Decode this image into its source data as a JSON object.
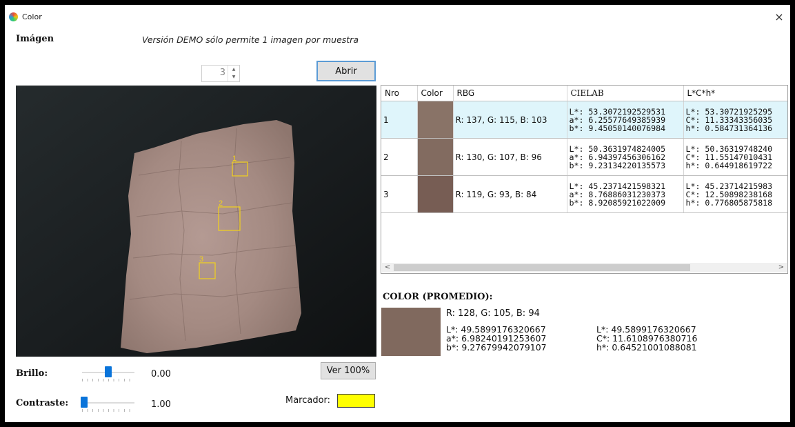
{
  "window": {
    "title": "Color",
    "close_glyph": "×"
  },
  "header": {
    "image_label": "Imágen",
    "demo_notice": "Versión DEMO sólo permite 1 imagen por muestra"
  },
  "spinner": {
    "value": "3",
    "up": "▲",
    "down": "▼"
  },
  "buttons": {
    "open": "Abrir",
    "view_full": "Ver 100%"
  },
  "photo": {
    "marker_color": "#f2d21c",
    "markers": [
      {
        "label": "1"
      },
      {
        "label": "2"
      },
      {
        "label": "3"
      }
    ]
  },
  "table": {
    "columns": [
      "Nro",
      "Color",
      "RBG",
      "CIELAB",
      "L*C*h*"
    ],
    "rows": [
      {
        "nro": "1",
        "color": "#897367",
        "rgb": "R: 137, G: 115, B: 103",
        "lab": [
          "L*: 53.3072192529531",
          "a*: 6.25577649385939",
          "b*: 9.45050140076984"
        ],
        "lch": [
          "L*: 53.30721925295",
          "C*: 11.33343356035",
          "h*: 0.584731364136"
        ]
      },
      {
        "nro": "2",
        "color": "#826b60",
        "rgb": "R: 130, G: 107, B: 96",
        "lab": [
          "L*: 50.3631974824005",
          "a*: 6.94397456306162",
          "b*: 9.23134220135573"
        ],
        "lch": [
          "L*: 50.36319748240",
          "C*: 11.55147010431",
          "h*: 0.644918619722"
        ]
      },
      {
        "nro": "3",
        "color": "#775d54",
        "rgb": "R: 119, G: 93, B: 84",
        "lab": [
          "L*: 45.2371421598321",
          "a*: 8.76886031230373",
          "b*: 8.92085921022009"
        ],
        "lch": [
          "L*: 45.23714215983",
          "C*: 12.50898238168",
          "h*: 0.776805875818"
        ]
      }
    ],
    "scroll_left": "<",
    "scroll_right": ">"
  },
  "average": {
    "title": "COLOR (PROMEDIO):",
    "color": "#80695e",
    "rgb": "R: 128, G: 105, B: 94",
    "lab": [
      "L*: 49.5899176320667",
      "a*: 6.98240191253607",
      "b*: 9.27679942079107"
    ],
    "lch": [
      "L*: 49.5899176320667",
      "C*: 11.6108976380716",
      "h*: 0.64521001088081"
    ]
  },
  "controls": {
    "brightness_label": "Brillo:",
    "brightness_value": "0.00",
    "brightness_level": 0.5,
    "contrast_label": "Contraste:",
    "contrast_value": "1.00",
    "contrast_level": 0.0,
    "marker_label": "Marcador:",
    "marker_color": "#ffff00"
  }
}
